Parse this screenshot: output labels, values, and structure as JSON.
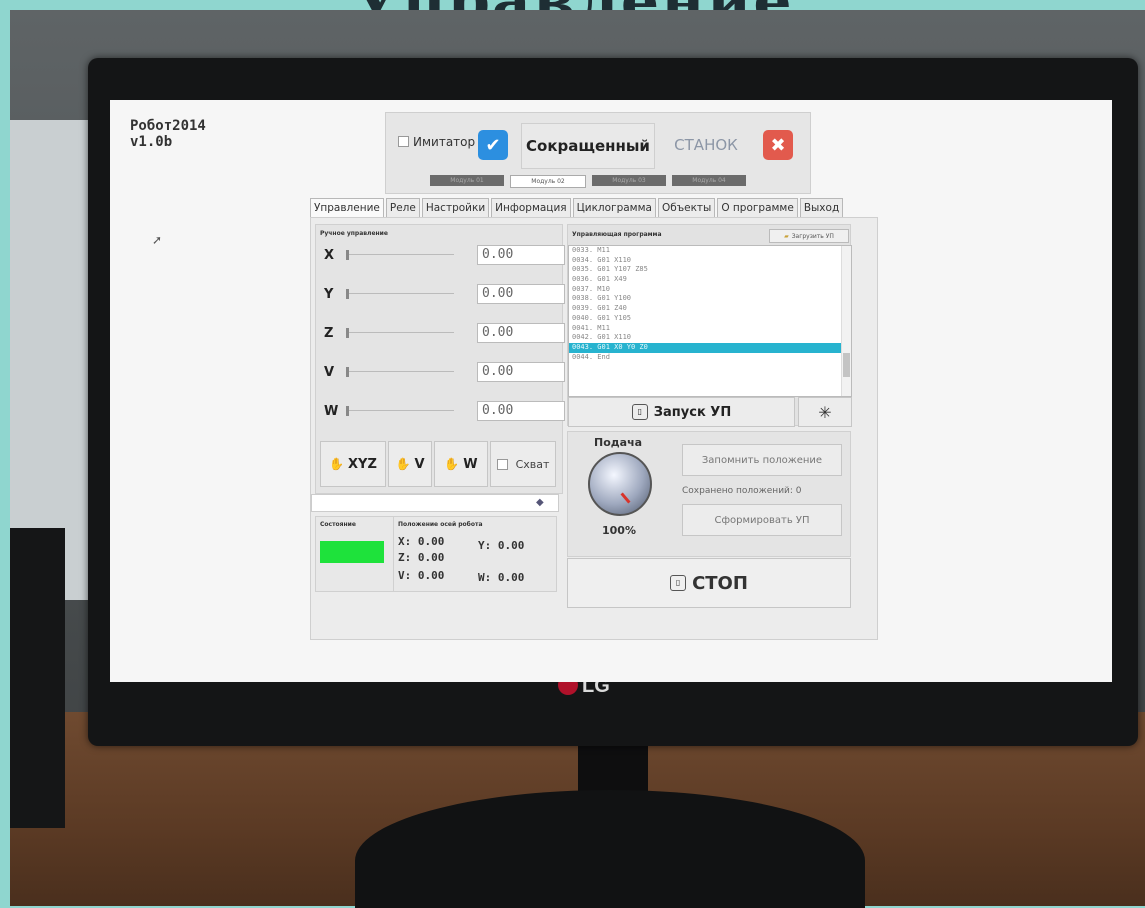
{
  "app": {
    "title": "Робот2014",
    "version": "v1.0b"
  },
  "toolbar": {
    "emulator_label": "Имитатор",
    "short_label": "Сокращенный",
    "machine_label": "СТАНОК",
    "modules": [
      "Модуль 01",
      "Модуль 02",
      "Модуль 03",
      "Модуль 04"
    ],
    "active_module": 1
  },
  "tabs": [
    "Управление",
    "Реле",
    "Настройки",
    "Информация",
    "Циклограмма",
    "Объекты",
    "О программе",
    "Выход"
  ],
  "manual": {
    "title": "Ручное управление",
    "axes": [
      {
        "name": "X",
        "value": "0.00"
      },
      {
        "name": "Y",
        "value": "0.00"
      },
      {
        "name": "Z",
        "value": "0.00"
      },
      {
        "name": "V",
        "value": "0.00"
      },
      {
        "name": "W",
        "value": "0.00"
      }
    ],
    "buttons": {
      "xyz": "XYZ",
      "v": "V",
      "w": "W",
      "grip": "Схват"
    }
  },
  "status": {
    "title": "Состояние",
    "led_color": "#1ee23b"
  },
  "position": {
    "title": "Положение осей робота",
    "x_label": "X:",
    "x": "0.00",
    "y_label": "Y:",
    "y": "0.00",
    "z_label": "Z:",
    "z": "0.00",
    "v_label": "V:",
    "v": "0.00",
    "w_label": "W:",
    "w": "0.00"
  },
  "program": {
    "title": "Управляющая программа",
    "load_label": "Загрузить УП",
    "lines": [
      "0033. M11",
      "0034. G01 X110",
      "0035. G01 Y107 Z85",
      "0036. G01 X49",
      "0037. M10",
      "0038. G01 Y100",
      "0039. G01 Z40",
      "0040. G01 Y105",
      "0041. M11",
      "0042. G01 X110",
      "0043. G01 X0 Y0 Z0",
      "0044. End"
    ],
    "selected_line": 10,
    "run_label": "Запуск УП",
    "accent_color": "#27b3cf"
  },
  "feed": {
    "label": "Подача",
    "value": "100%",
    "remember_label": "Запомнить положение",
    "saved_text": "Сохранено положений: 0",
    "form_label": "Сформировать УП"
  },
  "stop_label": "СТОП",
  "brand": "LG"
}
